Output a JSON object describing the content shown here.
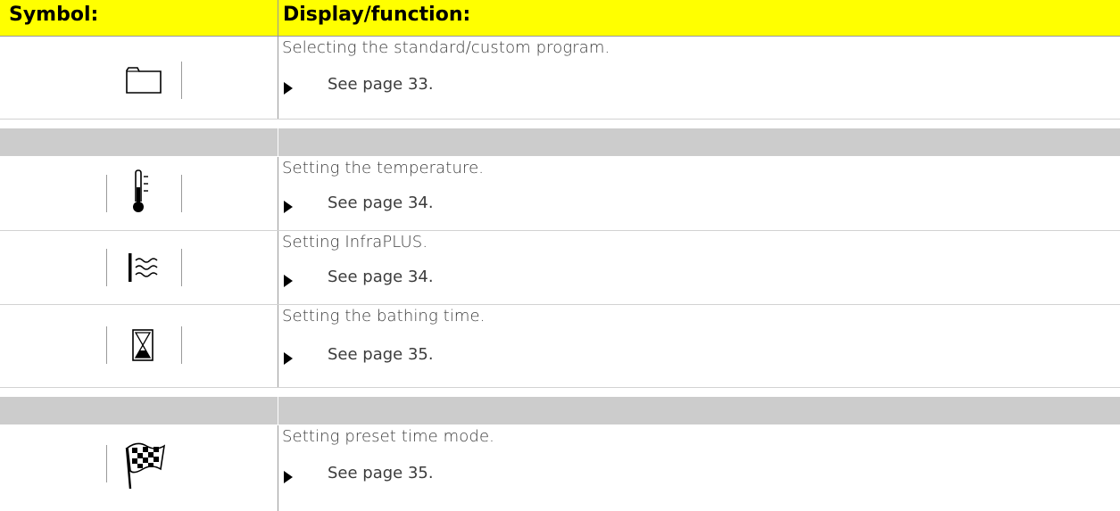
{
  "header": {
    "symbol_label": "Symbol:",
    "display_label": "Display/function:",
    "background_color": "#ffff00"
  },
  "rows": [
    {
      "icon": "folder-icon",
      "description": "Selecting the standard/custom program.",
      "reference": "See page 33."
    },
    {
      "icon": "thermometer-icon",
      "description": "Setting the temperature.",
      "reference": "See page 34."
    },
    {
      "icon": "infraplus-icon",
      "description": "Setting InfraPLUS.",
      "reference": "See page 34."
    },
    {
      "icon": "hourglass-icon",
      "description": "Setting the bathing time.",
      "reference": "See page 35."
    },
    {
      "icon": "checkered-flag-icon",
      "description": "Setting preset time mode.",
      "reference": "See page 35."
    }
  ],
  "separator_color": "#cccccc"
}
